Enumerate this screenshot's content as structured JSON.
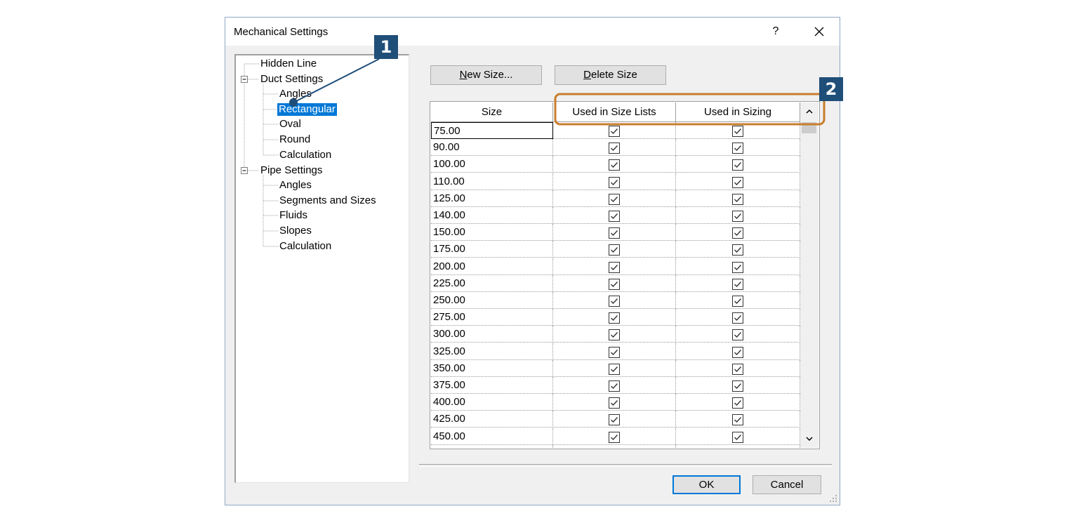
{
  "dialog": {
    "title": "Mechanical Settings",
    "help": "?"
  },
  "tree": {
    "hidden_line": "Hidden Line",
    "duct_settings": "Duct Settings",
    "duct_angles": "Angles",
    "duct_rectangular": "Rectangular",
    "duct_oval": "Oval",
    "duct_round": "Round",
    "duct_calculation": "Calculation",
    "pipe_settings": "Pipe Settings",
    "pipe_angles": "Angles",
    "pipe_segments": "Segments and Sizes",
    "pipe_fluids": "Fluids",
    "pipe_slopes": "Slopes",
    "pipe_calculation": "Calculation"
  },
  "buttons": {
    "new_size_mnemonic": "N",
    "new_size_rest": "ew Size...",
    "delete_size_mnemonic": "D",
    "delete_size_rest": "elete Size",
    "ok": "OK",
    "cancel": "Cancel"
  },
  "table": {
    "headers": {
      "size": "Size",
      "used_in_size_lists": "Used in Size Lists",
      "used_in_sizing": "Used in Sizing"
    },
    "rows": [
      {
        "size": "75.00",
        "used_in_size_lists": true,
        "used_in_sizing": true
      },
      {
        "size": "90.00",
        "used_in_size_lists": true,
        "used_in_sizing": true
      },
      {
        "size": "100.00",
        "used_in_size_lists": true,
        "used_in_sizing": true
      },
      {
        "size": "110.00",
        "used_in_size_lists": true,
        "used_in_sizing": true
      },
      {
        "size": "125.00",
        "used_in_size_lists": true,
        "used_in_sizing": true
      },
      {
        "size": "140.00",
        "used_in_size_lists": true,
        "used_in_sizing": true
      },
      {
        "size": "150.00",
        "used_in_size_lists": true,
        "used_in_sizing": true
      },
      {
        "size": "175.00",
        "used_in_size_lists": true,
        "used_in_sizing": true
      },
      {
        "size": "200.00",
        "used_in_size_lists": true,
        "used_in_sizing": true
      },
      {
        "size": "225.00",
        "used_in_size_lists": true,
        "used_in_sizing": true
      },
      {
        "size": "250.00",
        "used_in_size_lists": true,
        "used_in_sizing": true
      },
      {
        "size": "275.00",
        "used_in_size_lists": true,
        "used_in_sizing": true
      },
      {
        "size": "300.00",
        "used_in_size_lists": true,
        "used_in_sizing": true
      },
      {
        "size": "325.00",
        "used_in_size_lists": true,
        "used_in_sizing": true
      },
      {
        "size": "350.00",
        "used_in_size_lists": true,
        "used_in_sizing": true
      },
      {
        "size": "375.00",
        "used_in_size_lists": true,
        "used_in_sizing": true
      },
      {
        "size": "400.00",
        "used_in_size_lists": true,
        "used_in_sizing": true
      },
      {
        "size": "425.00",
        "used_in_size_lists": true,
        "used_in_sizing": true
      },
      {
        "size": "450.00",
        "used_in_size_lists": true,
        "used_in_sizing": true
      },
      {
        "size": "",
        "used_in_size_lists": true,
        "used_in_sizing": true
      }
    ]
  },
  "callouts": {
    "one": "1",
    "two": "2"
  },
  "colors": {
    "selection": "#0078d7",
    "callout_fill": "#1f4e79",
    "highlight_border": "#c97d2c",
    "dialog_bg": "#f0f0f0"
  }
}
